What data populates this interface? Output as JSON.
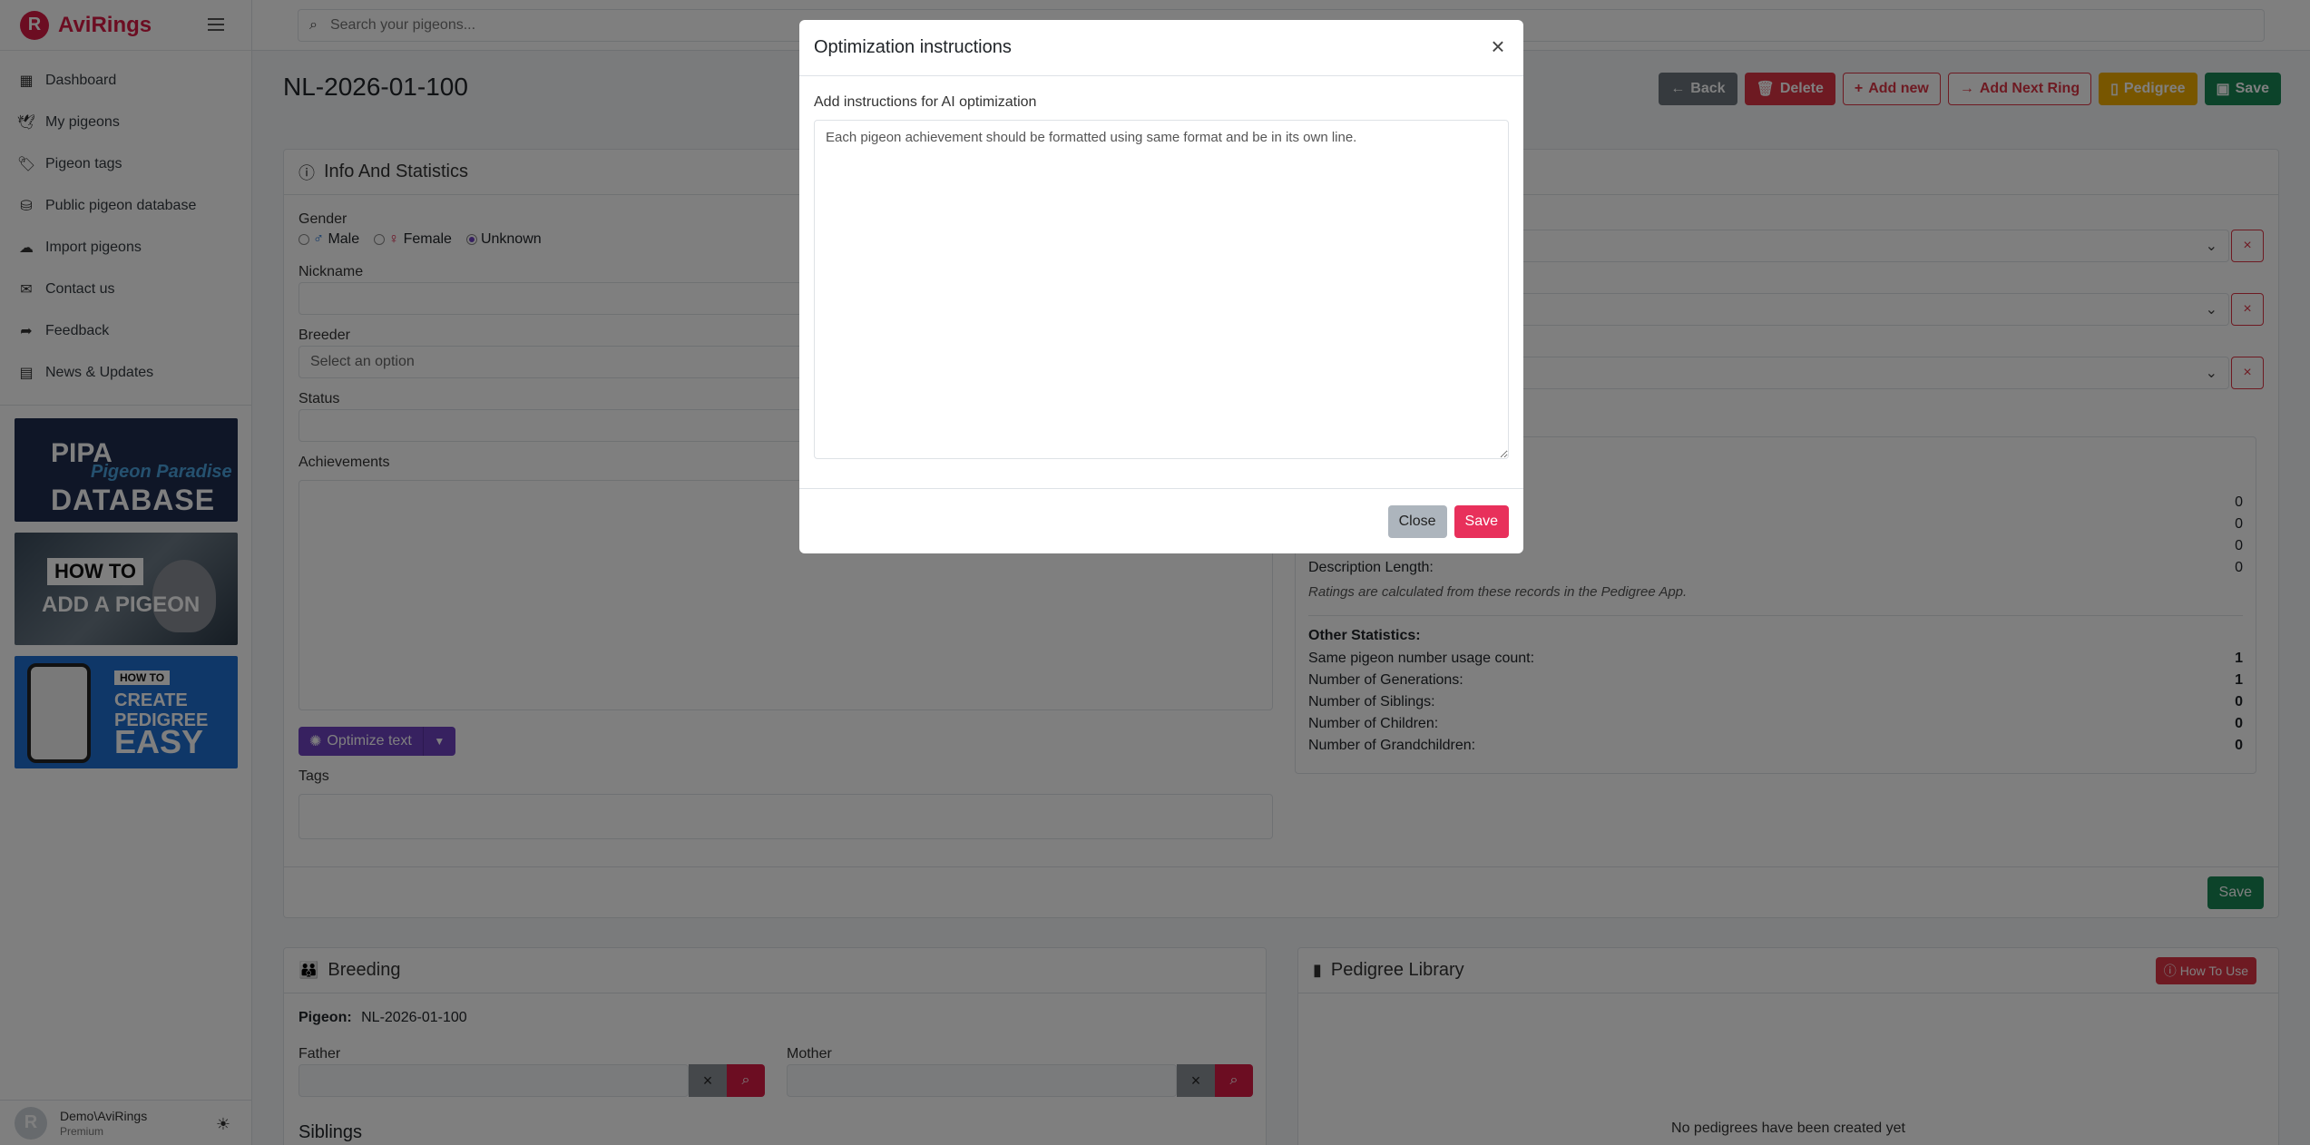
{
  "brand": {
    "logo": "R",
    "name": "AviRings"
  },
  "sidebar": {
    "items": [
      {
        "icon": "dashboard-icon",
        "glyph": "▦",
        "label": "Dashboard"
      },
      {
        "icon": "dove-icon",
        "glyph": "🕊",
        "label": "My pigeons"
      },
      {
        "icon": "tags-icon",
        "glyph": "🏷",
        "label": "Pigeon tags"
      },
      {
        "icon": "database-icon",
        "glyph": "⛁",
        "label": "Public pigeon database"
      },
      {
        "icon": "cloud-upload-icon",
        "glyph": "☁",
        "label": "Import pigeons"
      },
      {
        "icon": "envelope-icon",
        "glyph": "✉",
        "label": "Contact us"
      },
      {
        "icon": "share-icon",
        "glyph": "➦",
        "label": "Feedback"
      },
      {
        "icon": "newspaper-icon",
        "glyph": "▤",
        "label": "News & Updates"
      }
    ],
    "promos": {
      "pipa": {
        "line1": "PIPA",
        "line2": "Pigeon Paradise",
        "line3": "DATABASE"
      },
      "howto_add": {
        "tag": "HOW TO",
        "text": "ADD A PIGEON"
      },
      "howto_pedigree": {
        "tag": "HOW TO",
        "line1": "CREATE",
        "line2": "PEDIGREE",
        "line3": "EASY"
      }
    },
    "user": {
      "initial": "R",
      "name": "Demo\\AviRings",
      "plan": "Premium"
    }
  },
  "topbar": {
    "search_placeholder": "Search your pigeons..."
  },
  "page": {
    "title": "NL-2026-01-100",
    "actions": {
      "back": "Back",
      "delete": "Delete",
      "add_new": "Add new",
      "add_next_ring": "Add Next Ring",
      "pedigree": "Pedigree",
      "save": "Save"
    }
  },
  "info_card": {
    "title": "Info And Statistics",
    "gender_label": "Gender",
    "gender_options": [
      "Male",
      "Female",
      "Unknown"
    ],
    "gender_selected": "Unknown",
    "nickname_label": "Nickname",
    "breeder_label": "Breeder",
    "breeder_placeholder": "Select an option",
    "status_label": "Status",
    "achievements_label": "Achievements",
    "optimize_label": "Optimize text",
    "tags_label": "Tags",
    "save_label": "Save",
    "description_length_label": "Description Length:",
    "ratings_note": "Ratings are calculated from these records in the Pedigree App.",
    "rating_values": [
      "0",
      "0",
      "0",
      "0"
    ],
    "other_stats_title": "Other Statistics:",
    "other_stats": [
      {
        "label": "Same pigeon number usage count:",
        "value": "1"
      },
      {
        "label": "Number of Generations:",
        "value": "1"
      },
      {
        "label": "Number of Siblings:",
        "value": "0"
      },
      {
        "label": "Number of Children:",
        "value": "0"
      },
      {
        "label": "Number of Grandchildren:",
        "value": "0"
      }
    ]
  },
  "breeding_card": {
    "title": "Breeding",
    "pigeon_label": "Pigeon:",
    "pigeon_value": "NL-2026-01-100",
    "father_label": "Father",
    "mother_label": "Mother",
    "siblings_label": "Siblings"
  },
  "pedigree_card": {
    "title": "Pedigree Library",
    "how_to_use": "How To Use",
    "empty_text": "No pedigrees have been created yet"
  },
  "modal": {
    "title": "Optimization instructions",
    "label": "Add instructions for AI optimization",
    "textarea_value": "Each pigeon achievement should be formatted using same format and be in its own line.",
    "close_label": "Close",
    "save_label": "Save"
  },
  "colors": {
    "brand": "#d81b45",
    "purple": "#6f42c1",
    "success": "#198754",
    "warning": "#f0ad00",
    "danger": "#dc3545",
    "modal_save": "#e8305b"
  }
}
